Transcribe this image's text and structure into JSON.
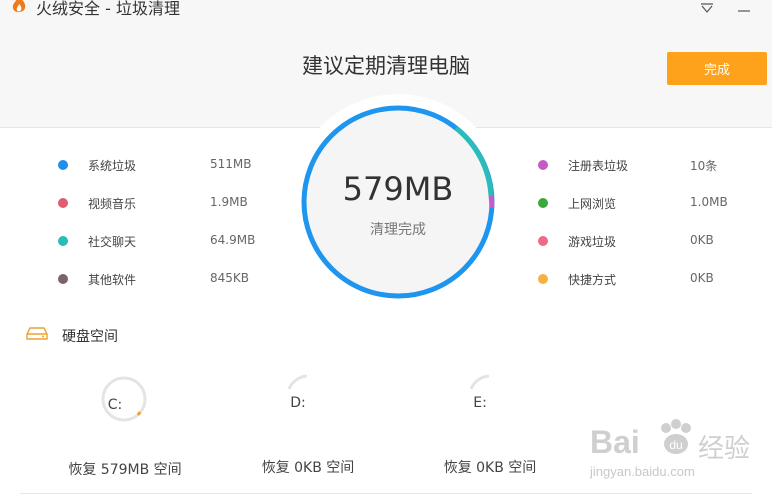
{
  "window": {
    "title": "火绒安全 - 垃圾清理"
  },
  "header": {
    "headline": "建议定期清理电脑",
    "done_button": "完成"
  },
  "summary": {
    "total": "579MB",
    "status": "清理完成"
  },
  "categories_left": [
    {
      "label": "系统垃圾",
      "value": "511MB",
      "color": "#1e8fec"
    },
    {
      "label": "视频音乐",
      "value": "1.9MB",
      "color": "#e05d6f"
    },
    {
      "label": "社交聊天",
      "value": "64.9MB",
      "color": "#2bbbb8"
    },
    {
      "label": "其他软件",
      "value": "845KB",
      "color": "#7d6368"
    }
  ],
  "categories_right": [
    {
      "label": "注册表垃圾",
      "value": "10条",
      "color": "#c45cc4"
    },
    {
      "label": "上网浏览",
      "value": "1.0MB",
      "color": "#3aa83a"
    },
    {
      "label": "游戏垃圾",
      "value": "0KB",
      "color": "#ee6b86"
    },
    {
      "label": "快捷方式",
      "value": "0KB",
      "color": "#f5b041"
    }
  ],
  "disk": {
    "title": "硬盘空间",
    "drives": [
      {
        "letter": "C:",
        "restore": "恢复 579MB 空间"
      },
      {
        "letter": "D:",
        "restore": "恢复 0KB 空间"
      },
      {
        "letter": "E:",
        "restore": "恢复 0KB 空间"
      }
    ]
  },
  "watermark": {
    "brand": "Bai",
    "brand_cn": "经验",
    "url": "jingyan.baidu.com"
  }
}
